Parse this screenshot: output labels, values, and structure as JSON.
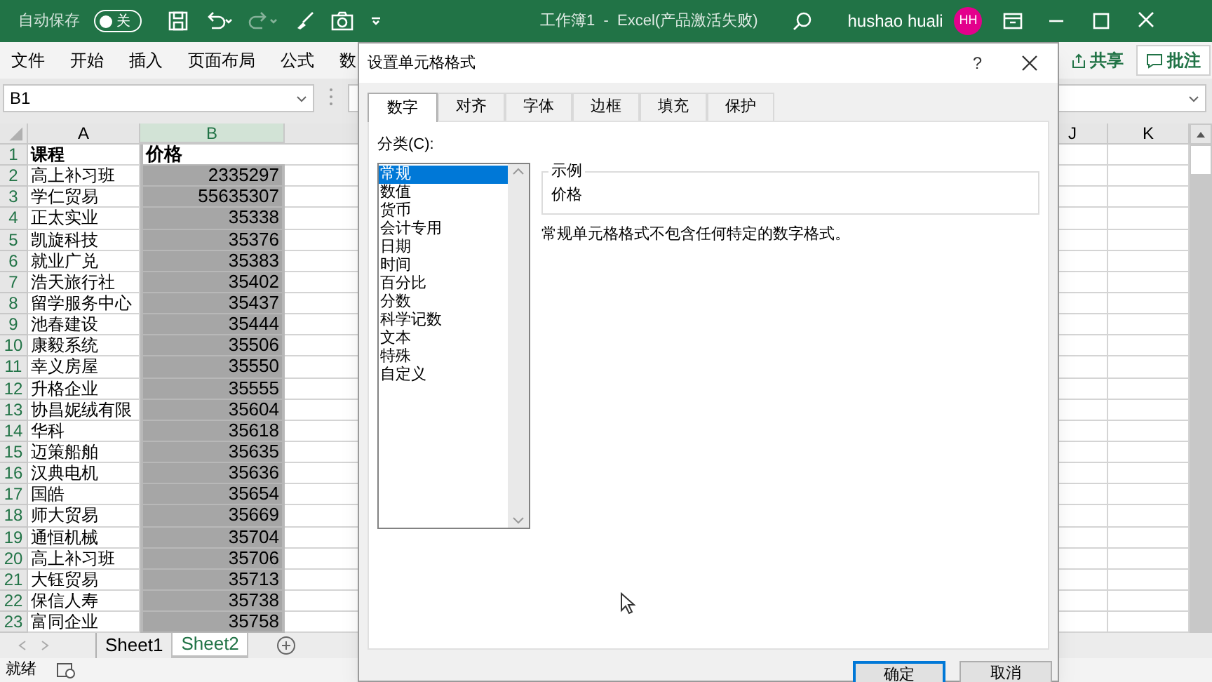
{
  "title_bar": {
    "autosave_label": "自动保存",
    "autosave_on": false,
    "toggle_text": "关",
    "title": "工作簿1  -  Excel(产品激活失败)",
    "user": "hushao huali",
    "avatar": "HH"
  },
  "ribbon_tabs": [
    "文件",
    "开始",
    "插入",
    "页面布局",
    "公式",
    "数"
  ],
  "ribbon_buttons": [
    "共享",
    "批注"
  ],
  "name_box": "B1",
  "columns": [
    {
      "label": "A",
      "selected": false
    },
    {
      "label": "B",
      "selected": true
    },
    {
      "label": "J",
      "selected": false
    },
    {
      "label": "K",
      "selected": false
    }
  ],
  "rows": [
    {
      "number": "1",
      "course": "课程",
      "price": "价格"
    },
    {
      "number": "2",
      "course": "高上补习班",
      "price": "2335297"
    },
    {
      "number": "3",
      "course": "学仁贸易",
      "price": "55635307"
    },
    {
      "number": "4",
      "course": "正太实业",
      "price": "35338"
    },
    {
      "number": "5",
      "course": "凯旋科技",
      "price": "35376"
    },
    {
      "number": "6",
      "course": "就业广兑",
      "price": "35383"
    },
    {
      "number": "7",
      "course": "浩天旅行社",
      "price": "35402"
    },
    {
      "number": "8",
      "course": "留学服务中心",
      "price": "35437"
    },
    {
      "number": "9",
      "course": "池春建设",
      "price": "35444"
    },
    {
      "number": "10",
      "course": "康毅系统",
      "price": "35506"
    },
    {
      "number": "11",
      "course": "幸义房屋",
      "price": "35550"
    },
    {
      "number": "12",
      "course": "升格企业",
      "price": "35555"
    },
    {
      "number": "13",
      "course": "协昌妮绒有限",
      "price": "35604"
    },
    {
      "number": "14",
      "course": "华科",
      "price": "35618"
    },
    {
      "number": "15",
      "course": "迈策船舶",
      "price": "35635"
    },
    {
      "number": "16",
      "course": "汉典电机",
      "price": "35636"
    },
    {
      "number": "17",
      "course": "国皓",
      "price": "35654"
    },
    {
      "number": "18",
      "course": "师大贸易",
      "price": "35669"
    },
    {
      "number": "19",
      "course": "通恒机械",
      "price": "35704"
    },
    {
      "number": "20",
      "course": "高上补习班",
      "price": "35706"
    },
    {
      "number": "21",
      "course": "大钰贸易",
      "price": "35713"
    },
    {
      "number": "22",
      "course": "保信人寿",
      "price": "35738"
    },
    {
      "number": "23",
      "course": "富同企业",
      "price": "35758"
    }
  ],
  "sheet_tabs": [
    {
      "label": "Sheet1",
      "selected": false
    },
    {
      "label": "Sheet2",
      "selected": true
    }
  ],
  "status": "就绪",
  "dialog": {
    "title": "设置单元格格式",
    "help": "?",
    "tabs": [
      {
        "label": "数字",
        "selected": true
      },
      {
        "label": "对齐",
        "selected": false
      },
      {
        "label": "字体",
        "selected": false
      },
      {
        "label": "边框",
        "selected": false
      },
      {
        "label": "填充",
        "selected": false
      },
      {
        "label": "保护",
        "selected": false
      }
    ],
    "category_label": "分类(C):",
    "categories": [
      {
        "label": "常规",
        "selected": true
      },
      {
        "label": "数值",
        "selected": false
      },
      {
        "label": "货币",
        "selected": false
      },
      {
        "label": "会计专用",
        "selected": false
      },
      {
        "label": "日期",
        "selected": false
      },
      {
        "label": "时间",
        "selected": false
      },
      {
        "label": "百分比",
        "selected": false
      },
      {
        "label": "分数",
        "selected": false
      },
      {
        "label": "科学记数",
        "selected": false
      },
      {
        "label": "文本",
        "selected": false
      },
      {
        "label": "特殊",
        "selected": false
      },
      {
        "label": "自定义",
        "selected": false
      }
    ],
    "sample_label": "示例",
    "sample_value": "价格",
    "description": "常规单元格格式不包含任何特定的数字格式。",
    "buttons": [
      "确定",
      "取消"
    ]
  }
}
